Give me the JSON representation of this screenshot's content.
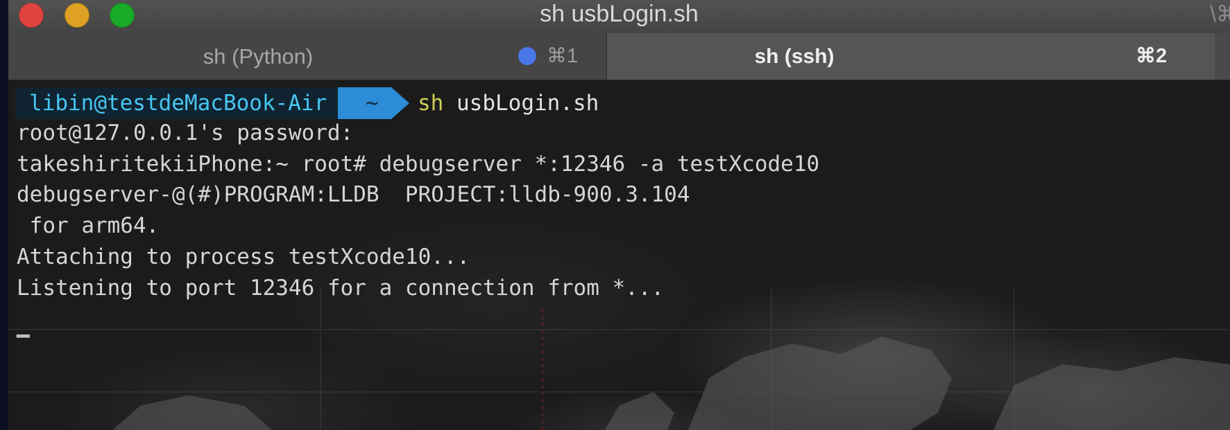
{
  "window": {
    "title": "sh usbLogin.sh",
    "title_shortcut": "\\⌘"
  },
  "tabs": [
    {
      "label": "sh (Python)",
      "shortcut": "⌘1",
      "active": false,
      "activity_dot_color": "#4a78e8"
    },
    {
      "label": "sh (ssh)",
      "shortcut": "⌘2",
      "active": true
    }
  ],
  "prompt": {
    "user_host": "libin@testdeMacBook-Air",
    "directory": "~",
    "command_name": "sh",
    "command_args": "usbLogin.sh"
  },
  "output": [
    "root@127.0.0.1's password:",
    "takeshiritekiiPhone:~ root# debugserver *:12346 -a testXcode10",
    "debugserver-@(#)PROGRAM:LLDB  PROJECT:lldb-900.3.104",
    " for arm64.",
    "Attaching to process testXcode10...",
    "Listening to port 12346 for a connection from *..."
  ],
  "colors": {
    "prompt_user_bg": "#0f2330",
    "prompt_user_fg": "#47c6f0",
    "prompt_dir_bg": "#2c8cd6",
    "command_name": "#cfd058",
    "terminal_text": "#d6d6d6"
  }
}
